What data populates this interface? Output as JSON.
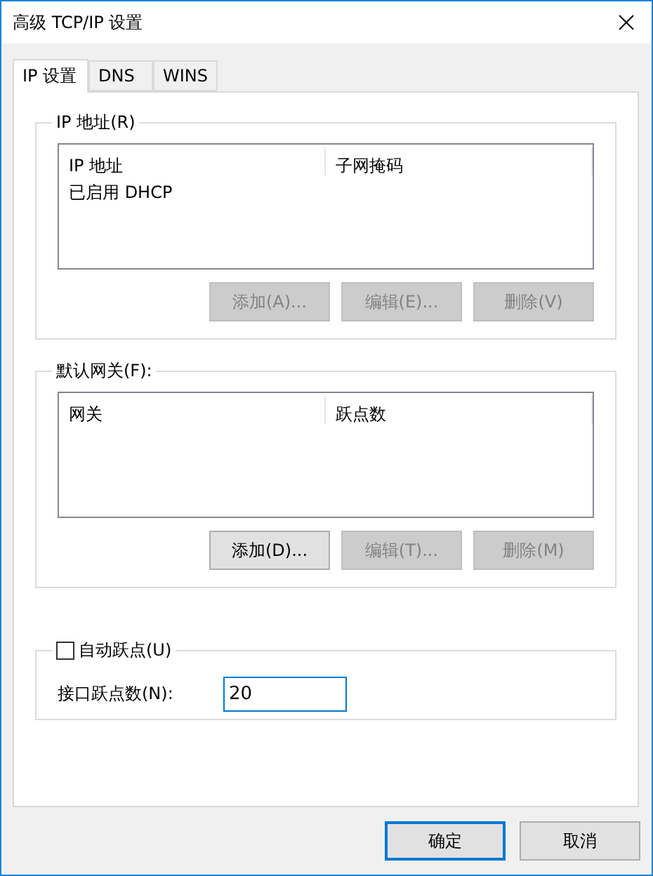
{
  "window": {
    "title": "高级 TCP/IP 设置"
  },
  "tabs": [
    {
      "label": "IP 设置",
      "selected": true
    },
    {
      "label": "DNS",
      "selected": false
    },
    {
      "label": "WINS",
      "selected": false
    }
  ],
  "ip_addresses": {
    "label": "IP 地址(R)",
    "columns": [
      "IP 地址",
      "子网掩码"
    ],
    "rows": [
      [
        "已启用 DHCP"
      ]
    ],
    "buttons": [
      {
        "label": "添加(A)...",
        "disabled": true
      },
      {
        "label": "编辑(E)...",
        "disabled": true
      },
      {
        "label": "删除(V)",
        "disabled": true
      }
    ]
  },
  "default_gateways": {
    "label": "默认网关(F):",
    "columns": [
      "网关",
      "跃点数"
    ],
    "buttons": [
      {
        "label": "添加(D)...",
        "disabled": false
      },
      {
        "label": "编辑(T)...",
        "disabled": true
      },
      {
        "label": "删除(M)",
        "disabled": true
      }
    ]
  },
  "metric": {
    "auto_metric": {
      "label": "自动跃点(U)",
      "checked": false
    },
    "interface_metric": {
      "label": "接口跃点数(N):",
      "value": "20"
    }
  },
  "buttons": [
    {
      "label": "确定",
      "default": true
    },
    {
      "label": "取消",
      "default": false
    }
  ]
}
